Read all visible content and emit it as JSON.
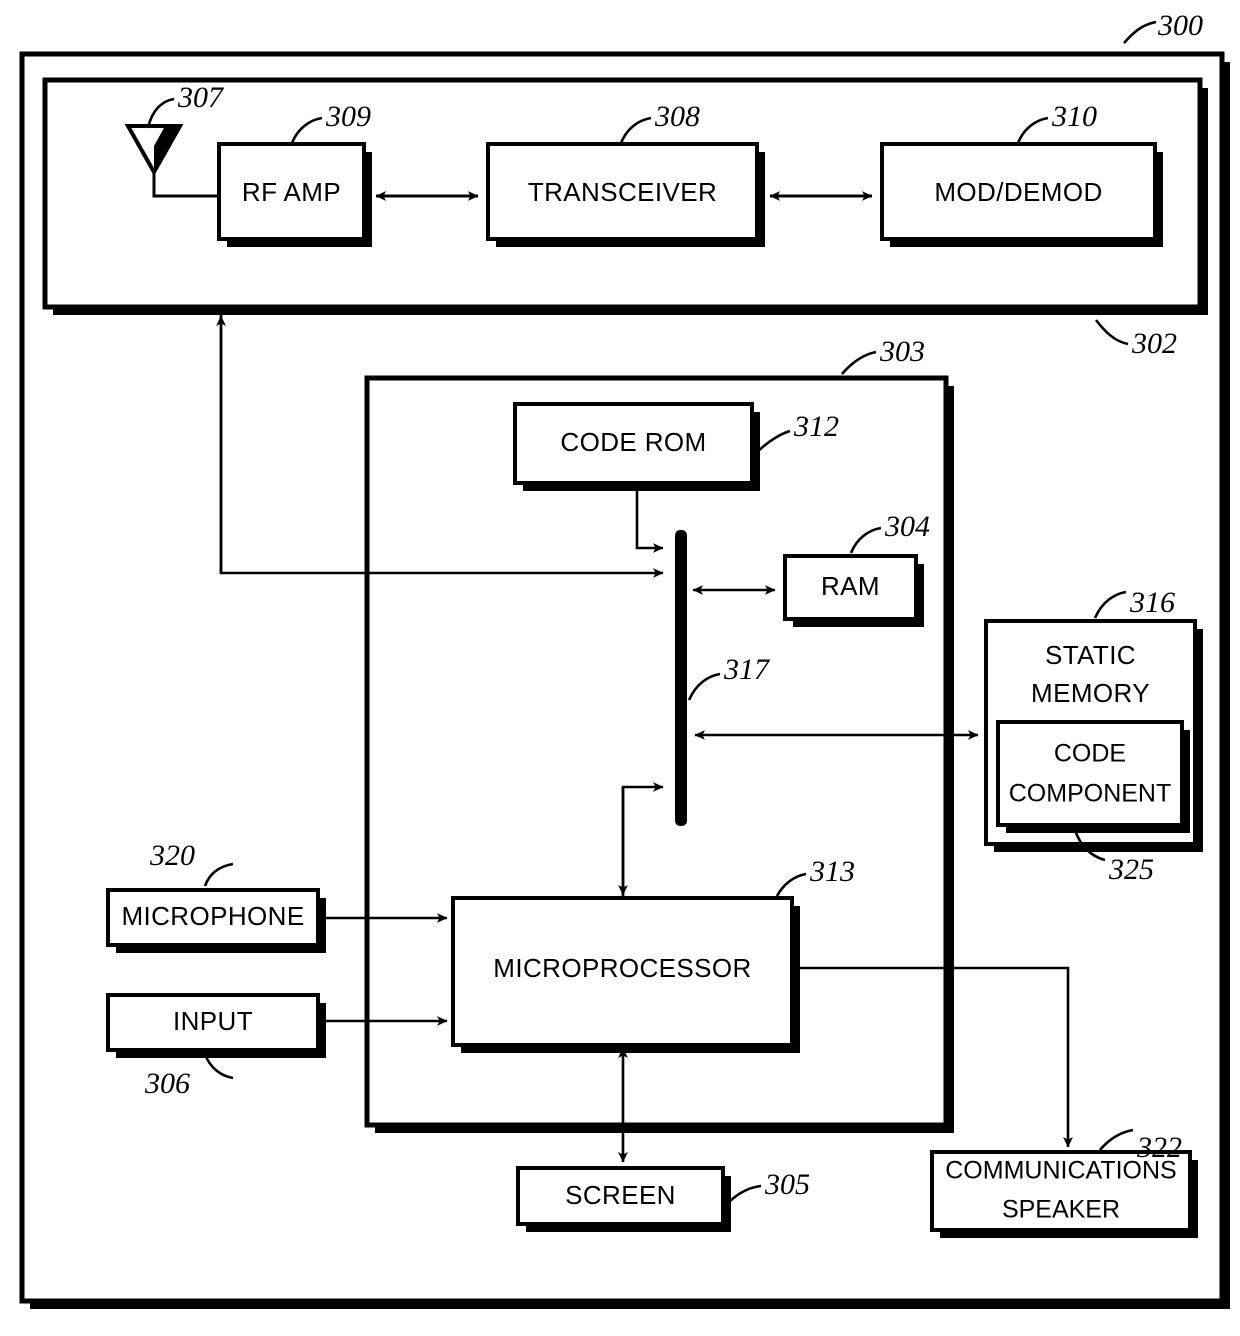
{
  "figure": {
    "type": "patent-block-diagram",
    "title_number": "300",
    "background_color": "#ffffff",
    "line_color": "#000000"
  },
  "containers": [
    {
      "name": "device-outer",
      "ref": "300",
      "label": ""
    },
    {
      "name": "rf-section",
      "ref": "302",
      "label": ""
    },
    {
      "name": "processing-section",
      "ref": "303",
      "label": ""
    }
  ],
  "blocks": {
    "antenna": {
      "label": "",
      "ref": "307"
    },
    "rf_amp": {
      "label": "RF AMP",
      "ref": "309"
    },
    "transceiver": {
      "label": "TRANSCEIVER",
      "ref": "308"
    },
    "mod_demod": {
      "label": "MOD/DEMOD",
      "ref": "310"
    },
    "code_rom": {
      "label": "CODE ROM",
      "ref": "312"
    },
    "ram": {
      "label": "RAM",
      "ref": "304"
    },
    "bus": {
      "label": "",
      "ref": "317"
    },
    "static_memory": {
      "line1": "STATIC",
      "line2": "MEMORY",
      "ref": "316"
    },
    "code_component": {
      "line1": "CODE",
      "line2": "COMPONENT",
      "ref": "325"
    },
    "microphone": {
      "label": "MICROPHONE",
      "ref": "320"
    },
    "input": {
      "label": "INPUT",
      "ref": "306"
    },
    "microprocessor": {
      "label": "MICROPROCESSOR",
      "ref": "313"
    },
    "screen": {
      "label": "SCREEN",
      "ref": "305"
    },
    "communications_speaker": {
      "line1": "COMMUNICATIONS",
      "line2": "SPEAKER",
      "ref": "322"
    }
  },
  "reference_numerals": [
    "300",
    "302",
    "303",
    "304",
    "305",
    "306",
    "307",
    "308",
    "309",
    "310",
    "312",
    "313",
    "316",
    "317",
    "320",
    "322",
    "325"
  ]
}
